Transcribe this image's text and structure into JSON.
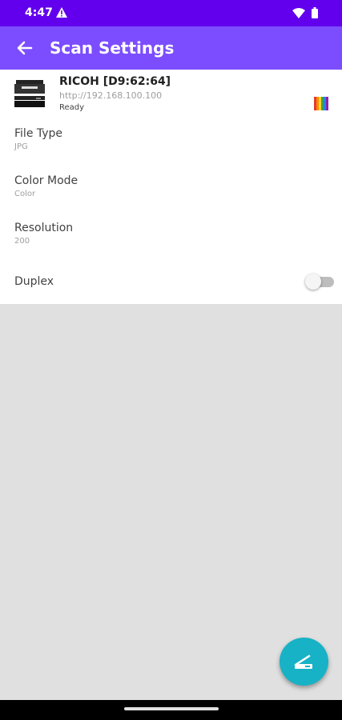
{
  "status_bar": {
    "time": "4:47"
  },
  "app_bar": {
    "title": "Scan Settings"
  },
  "printer": {
    "name": "RICOH [D9:62:64]",
    "url": "http://192.168.100.100",
    "status": "Ready"
  },
  "settings": [
    {
      "label": "File Type",
      "value": "JPG"
    },
    {
      "label": "Color Mode",
      "value": "Color"
    },
    {
      "label": "Resolution",
      "value": "200"
    }
  ],
  "duplex": {
    "label": "Duplex",
    "enabled": false
  },
  "colors": {
    "status_bar": "#6200ee",
    "app_bar": "#7c4dff",
    "fab": "#17b2c6",
    "background": "#e0e0e0"
  },
  "icons": {
    "back": "arrow-left-icon",
    "printer": "printer-icon",
    "color": "color-spectrum-icon",
    "fab": "scanner-icon"
  }
}
